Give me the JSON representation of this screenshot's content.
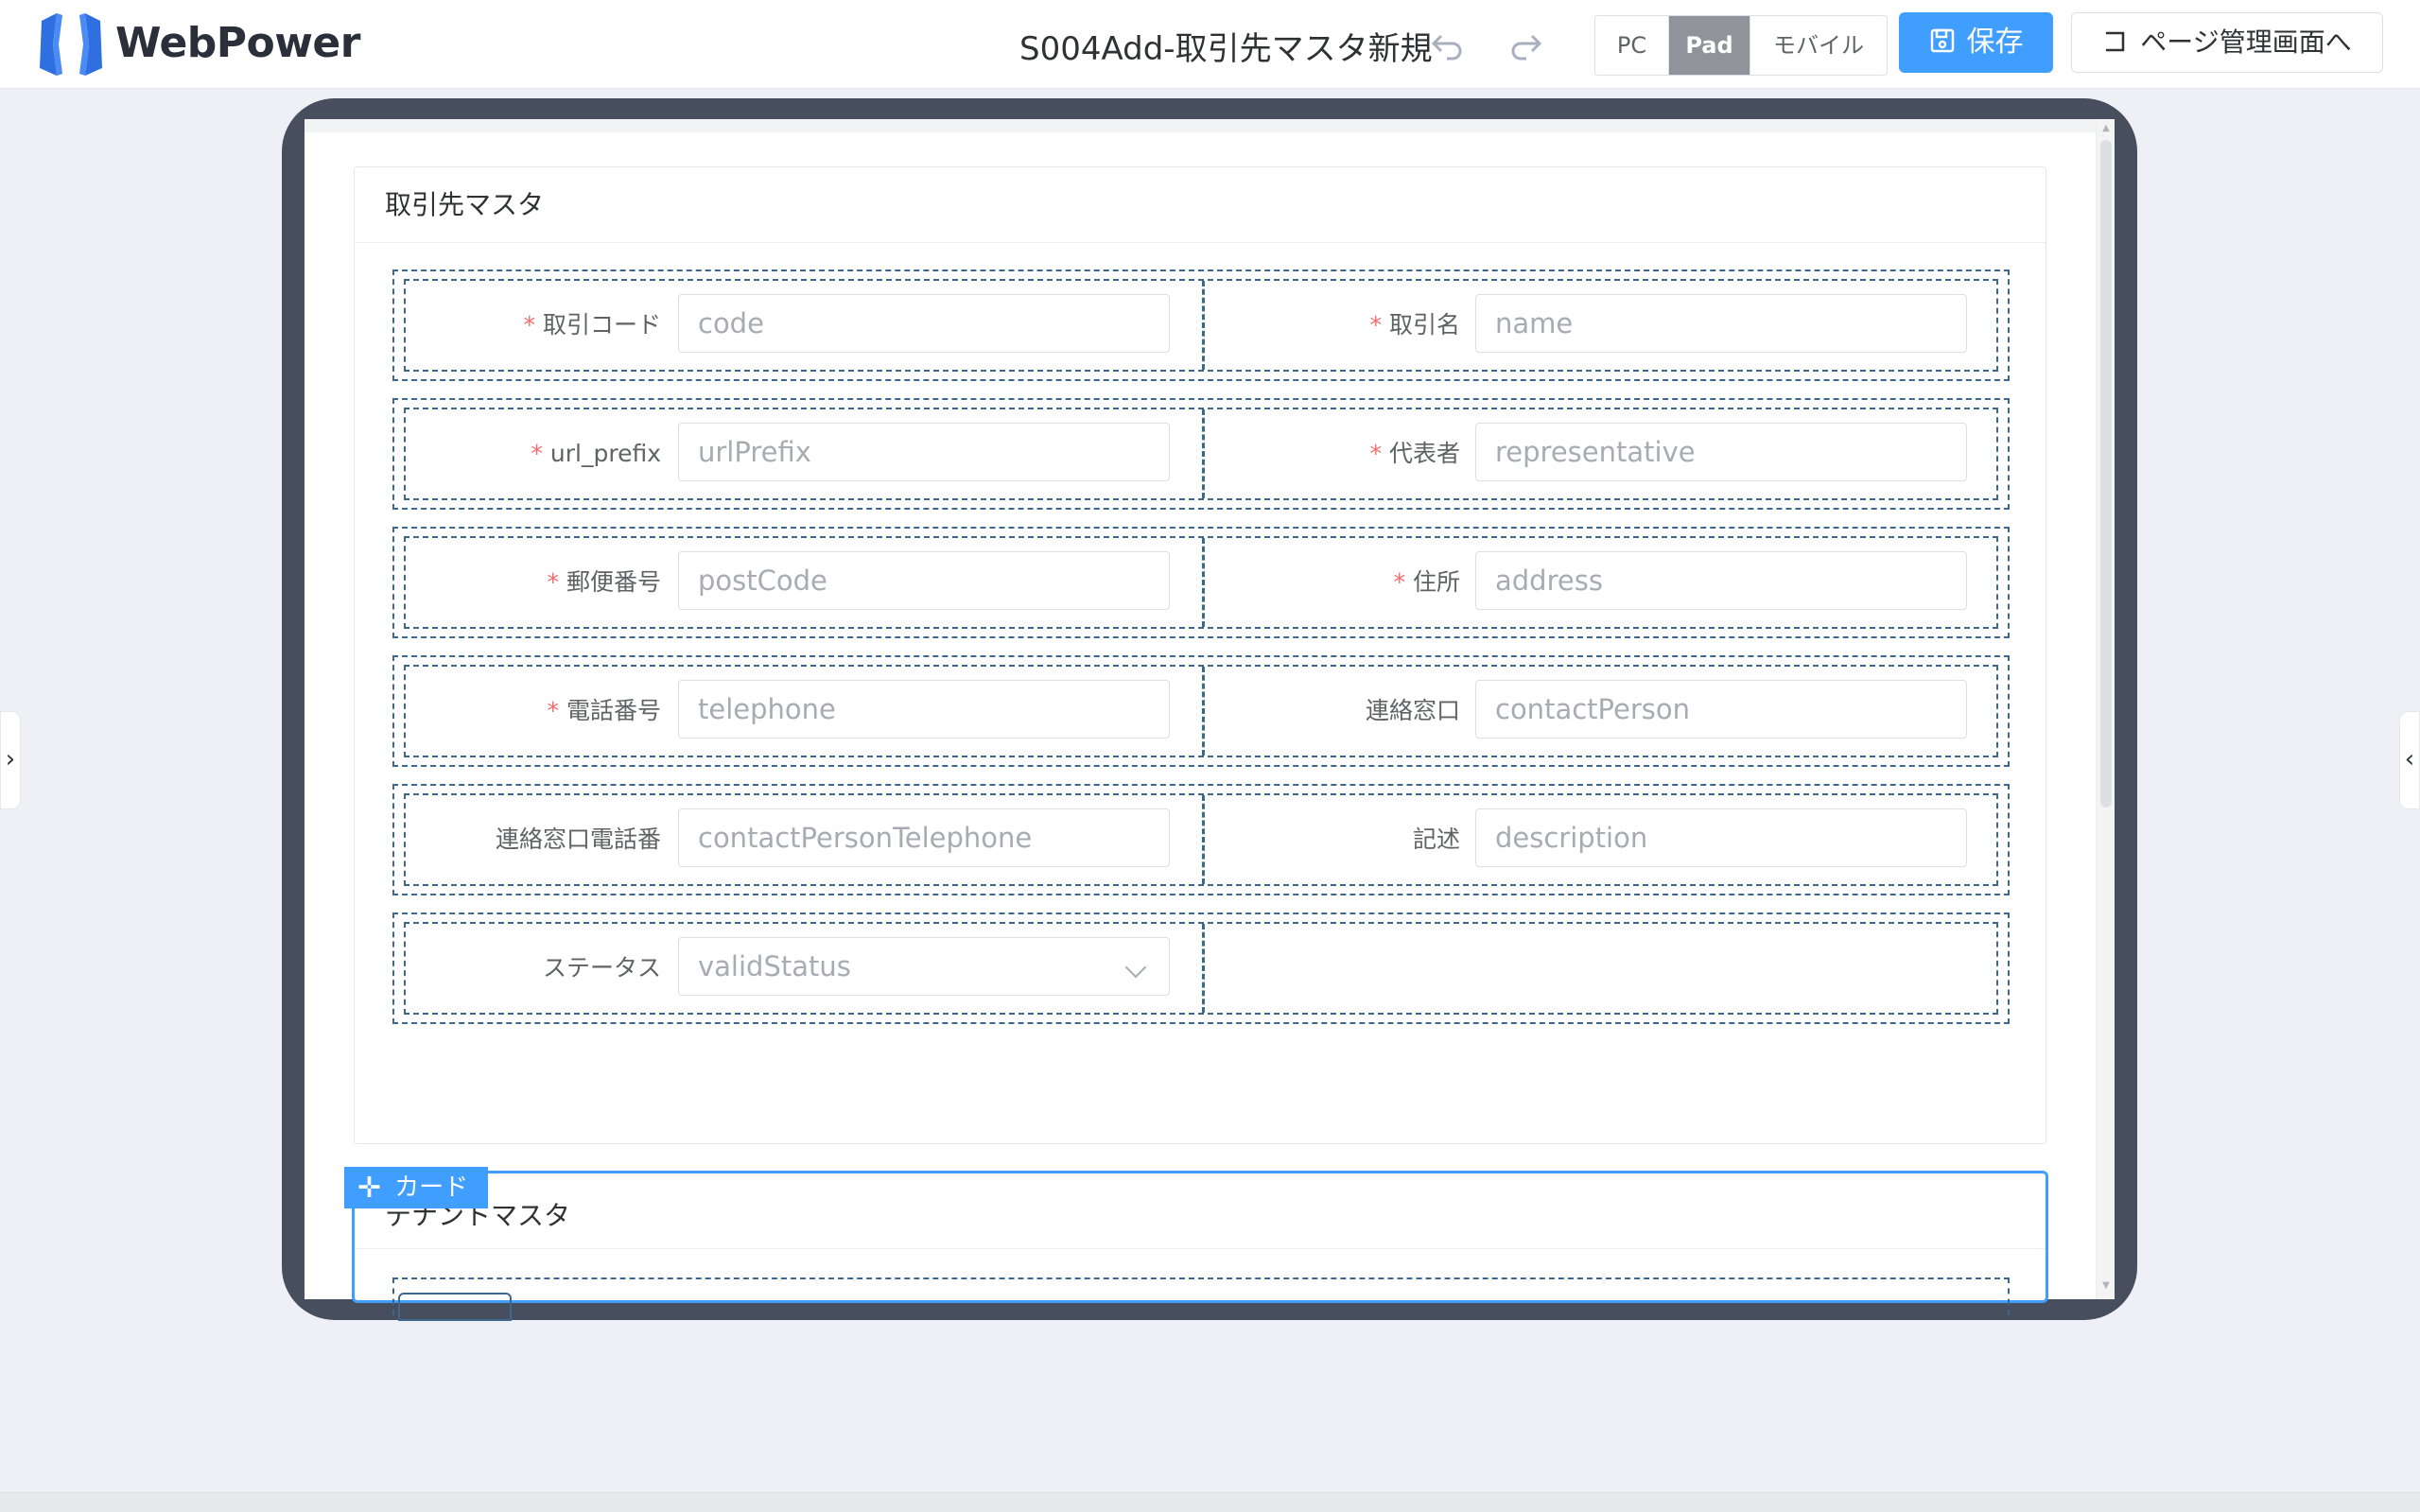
{
  "header": {
    "brand": "WebPower",
    "page_title": "S004Add-取引先マスタ新規",
    "undo_icon": "undo-icon",
    "redo_icon": "redo-icon",
    "devices": [
      "PC",
      "Pad",
      "モバイル"
    ],
    "active_device": "Pad",
    "save_label": "保存",
    "manage_label": "ページ管理画面へ"
  },
  "card1": {
    "title": "取引先マスタ",
    "rows": [
      {
        "left": {
          "label": "取引コード",
          "required": "*",
          "placeholder": "code"
        },
        "right": {
          "label": "取引名",
          "required": "*",
          "placeholder": "name"
        }
      },
      {
        "left": {
          "label": "url_prefix",
          "required": "*",
          "placeholder": "urlPrefix"
        },
        "right": {
          "label": "代表者",
          "required": "*",
          "placeholder": "representative"
        }
      },
      {
        "left": {
          "label": "郵便番号",
          "required": "*",
          "placeholder": "postCode"
        },
        "right": {
          "label": "住所",
          "required": "*",
          "placeholder": "address"
        }
      },
      {
        "left": {
          "label": "電話番号",
          "required": "*",
          "placeholder": "telephone"
        },
        "right": {
          "label": "連絡窓口",
          "required": "",
          "placeholder": "contactPerson"
        }
      },
      {
        "left": {
          "label": "連絡窓口電話番",
          "required": "",
          "placeholder": "contactPersonTelephone"
        },
        "right": {
          "label": "記述",
          "required": "",
          "placeholder": "description"
        }
      },
      {
        "left": {
          "label": "ステータス",
          "required": "",
          "placeholder": "validStatus"
        }
      }
    ]
  },
  "card2": {
    "tag_label": "カード",
    "title": "テナントマスタ"
  },
  "colors": {
    "primary": "#409eff",
    "frame": "#474f5f",
    "dashed_border": "#3c6790",
    "required": "#f56c6c"
  }
}
